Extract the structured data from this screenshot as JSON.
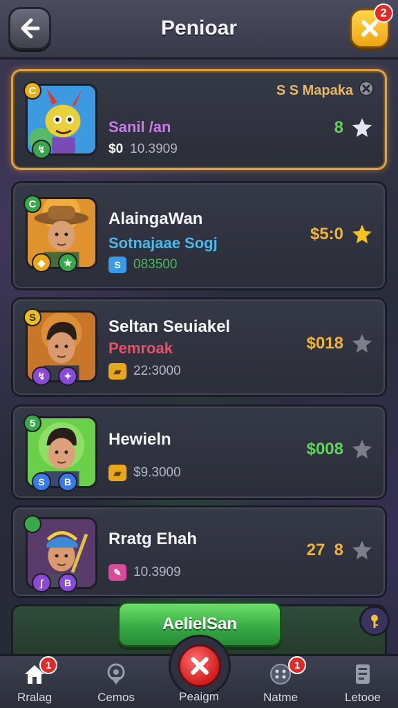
{
  "header": {
    "title": "Penioar",
    "close_badge": "2"
  },
  "cards": [
    {
      "top_label": "S S Mapaka",
      "level": "C",
      "name": "Sanil /an",
      "stat_prefix": "$0",
      "stat": "10.3909",
      "price": "8",
      "selected": true
    },
    {
      "level": "C",
      "name": "AlaingaWan",
      "subname": "Sotnajaae Sogj",
      "stat": "083500",
      "price": "$5:0"
    },
    {
      "level": "S",
      "name": "Seltan Seuiakel",
      "subname": "Pemroak",
      "stat": "22:3000",
      "price": "$018"
    },
    {
      "level": "5",
      "name": "Hewieln",
      "stat": "$9.3000",
      "price": "$008"
    },
    {
      "level": "",
      "name": "Rratg Ehah",
      "stat": "10.3909",
      "price": "27  8"
    }
  ],
  "claim_label": "AelielSan",
  "nav": [
    {
      "label": "Rralag",
      "badge": "1"
    },
    {
      "label": "Cemos"
    },
    {
      "label": "Peaigm"
    },
    {
      "label": "Natme",
      "badge": "1"
    },
    {
      "label": "Letooe"
    }
  ],
  "colors": {
    "accent_gold": "#e6a23a",
    "price_green": "#5fd35a",
    "price_gold": "#f0b43a",
    "claim_green": "#34a844",
    "close_red": "#d01f1f"
  }
}
